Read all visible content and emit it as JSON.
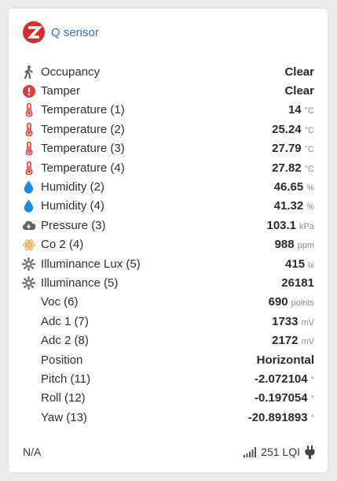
{
  "device": {
    "name": "Q sensor",
    "logo_letter": "Z"
  },
  "rows": [
    {
      "icon": "person-walking-icon",
      "label": "Occupancy",
      "value": "Clear",
      "unit": ""
    },
    {
      "icon": "exclamation-circle-icon",
      "label": "Tamper",
      "value": "Clear",
      "unit": ""
    },
    {
      "icon": "thermometer-icon",
      "label": "Temperature (1)",
      "value": "14",
      "unit": "°C"
    },
    {
      "icon": "thermometer-icon",
      "label": "Temperature (2)",
      "value": "25.24",
      "unit": "°C"
    },
    {
      "icon": "thermometer-icon",
      "label": "Temperature (3)",
      "value": "27.79",
      "unit": "°C"
    },
    {
      "icon": "thermometer-icon",
      "label": "Temperature (4)",
      "value": "27.82",
      "unit": "°C"
    },
    {
      "icon": "water-drop-icon",
      "label": "Humidity (2)",
      "value": "46.65",
      "unit": "%"
    },
    {
      "icon": "water-drop-icon",
      "label": "Humidity (4)",
      "value": "41.32",
      "unit": "%"
    },
    {
      "icon": "cloud-download-icon",
      "label": "Pressure (3)",
      "value": "103.1",
      "unit": "kPa"
    },
    {
      "icon": "atom-gear-icon",
      "label": "Co 2 (4)",
      "value": "988",
      "unit": "ppm"
    },
    {
      "icon": "sun-icon",
      "label": "Illuminance Lux (5)",
      "value": "415",
      "unit": "lx"
    },
    {
      "icon": "sun-icon",
      "label": "Illuminance (5)",
      "value": "26181",
      "unit": ""
    },
    {
      "icon": "",
      "label": "Voc (6)",
      "value": "690",
      "unit": "points"
    },
    {
      "icon": "",
      "label": "Adc 1 (7)",
      "value": "1733",
      "unit": "mV"
    },
    {
      "icon": "",
      "label": "Adc 2 (8)",
      "value": "2172",
      "unit": "mV"
    },
    {
      "icon": "",
      "label": "Position",
      "value": "Horizontal",
      "unit": ""
    },
    {
      "icon": "",
      "label": "Pitch (11)",
      "value": "-2.072104",
      "unit": "°"
    },
    {
      "icon": "",
      "label": "Roll (12)",
      "value": "-0.197054",
      "unit": "°"
    },
    {
      "icon": "",
      "label": "Yaw (13)",
      "value": "-20.891893",
      "unit": "°"
    }
  ],
  "footer": {
    "last_seen": "N/A",
    "lqi": "251 LQI",
    "signal_icon": "signal-bars-icon",
    "power_icon": "plug-icon"
  },
  "colors": {
    "accent": "#2f74d0",
    "logo": "#d32f2f",
    "thermo": "#e53935",
    "drop": "#1e88e5",
    "icon_gray": "#5f6368",
    "co2": "#f4b04f"
  }
}
